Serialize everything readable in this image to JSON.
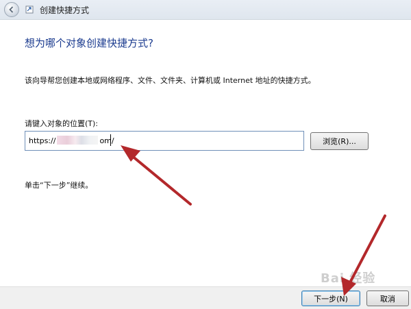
{
  "window": {
    "title": "创建快捷方式"
  },
  "main": {
    "heading": "想为哪个对象创建快捷方式?",
    "description": "该向导帮您创建本地或网络程序、文件、文件夹、计算机或 Internet 地址的快捷方式。",
    "location_label": "请键入对象的位置(T):",
    "location_value": "https://",
    "location_value_tail": "om/",
    "browse_label": "浏览(R)...",
    "hint": "单击“下一步”继续。"
  },
  "footer": {
    "next_label": "下一步(N)",
    "cancel_label": "取消"
  },
  "watermark": {
    "text": "Bai 经验"
  },
  "colors": {
    "heading": "#1b3b8f",
    "annotation_arrow": "#b3282b",
    "titlebar": "#e4eaf2"
  },
  "icons": [
    "back-arrow-icon",
    "shortcut-icon"
  ]
}
